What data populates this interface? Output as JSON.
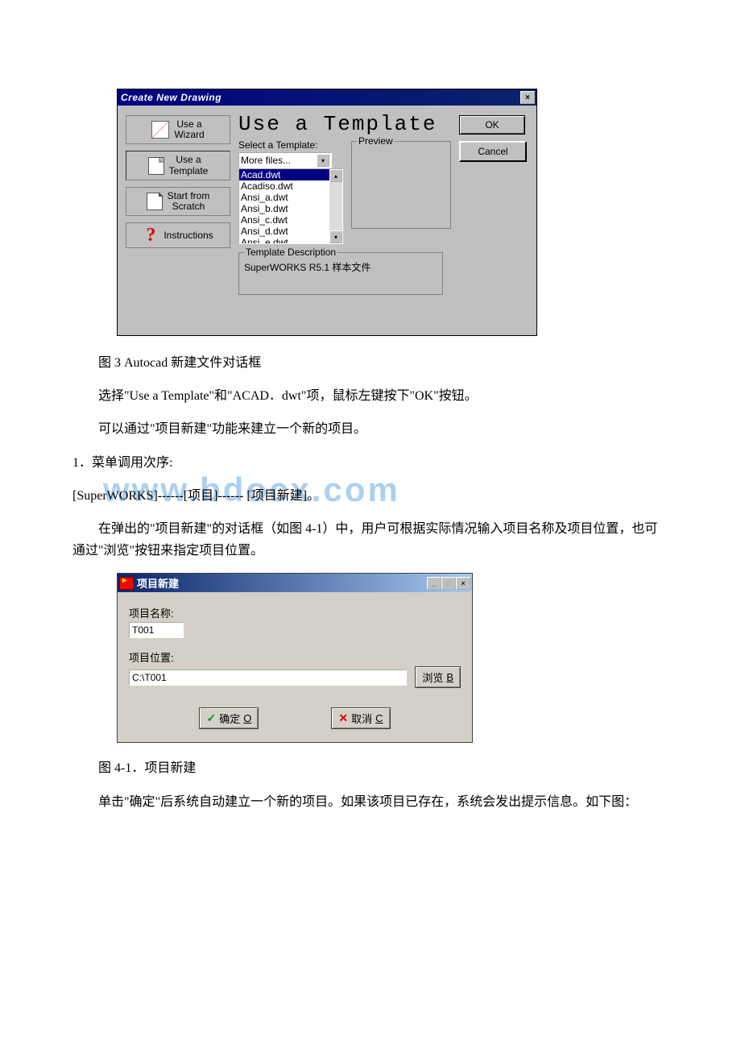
{
  "dialog1": {
    "title": "Create New Drawing",
    "close_icon": "×",
    "sidebar": [
      {
        "line1": "Use a",
        "line2": "Wizard"
      },
      {
        "line1": "Use a",
        "line2": "Template"
      },
      {
        "line1": "Start from",
        "line2": "Scratch"
      },
      {
        "line1": "Instructions",
        "line2": ""
      }
    ],
    "main_title": "Use a Template",
    "select_label": "Select a Template:",
    "more_files": "More files...",
    "list": [
      "Acad.dwt",
      "Acadiso.dwt",
      "Ansi_a.dwt",
      "Ansi_b.dwt",
      "Ansi_c.dwt",
      "Ansi_d.dwt",
      "Ansi_e.dwt"
    ],
    "preview_legend": "Preview",
    "desc_legend": "Template Description",
    "desc_text": "SuperWORKS R5.1 样本文件",
    "ok": "OK",
    "cancel": "Cancel"
  },
  "text": {
    "fig3": "图 3 Autocad 新建文件对话框",
    "p1": "选择\"Use a Template\"和\"ACAD．dwt\"项，鼠标左键按下\"OK\"按钮。",
    "p2": "可以通过\"项目新建\"功能来建立一个新的项目。",
    "p3": "1．菜单调用次序:",
    "p4": "[SuperWORKS]------[项目]------ [项目新建]。",
    "p5": "在弹出的\"项目新建\"的对话框（如图 4-1）中，用户可根据实际情况输入项目名称及项目位置，也可通过\"浏览\"按钮来指定项目位置。",
    "fig41": "图 4-1．项目新建",
    "p6": "单击\"确定\"后系统自动建立一个新的项目。如果该项目已存在，系统会发出提示信息。如下图：",
    "watermark": "www.bdocx.com"
  },
  "dialog2": {
    "title": "项目新建",
    "name_label": "项目名称:",
    "name_value": "T001",
    "loc_label": "项目位置:",
    "loc_value": "C:\\T001",
    "browse": "浏览",
    "browse_key": "B",
    "ok": "确定",
    "ok_key": "O",
    "cancel": "取消",
    "cancel_key": "C"
  }
}
